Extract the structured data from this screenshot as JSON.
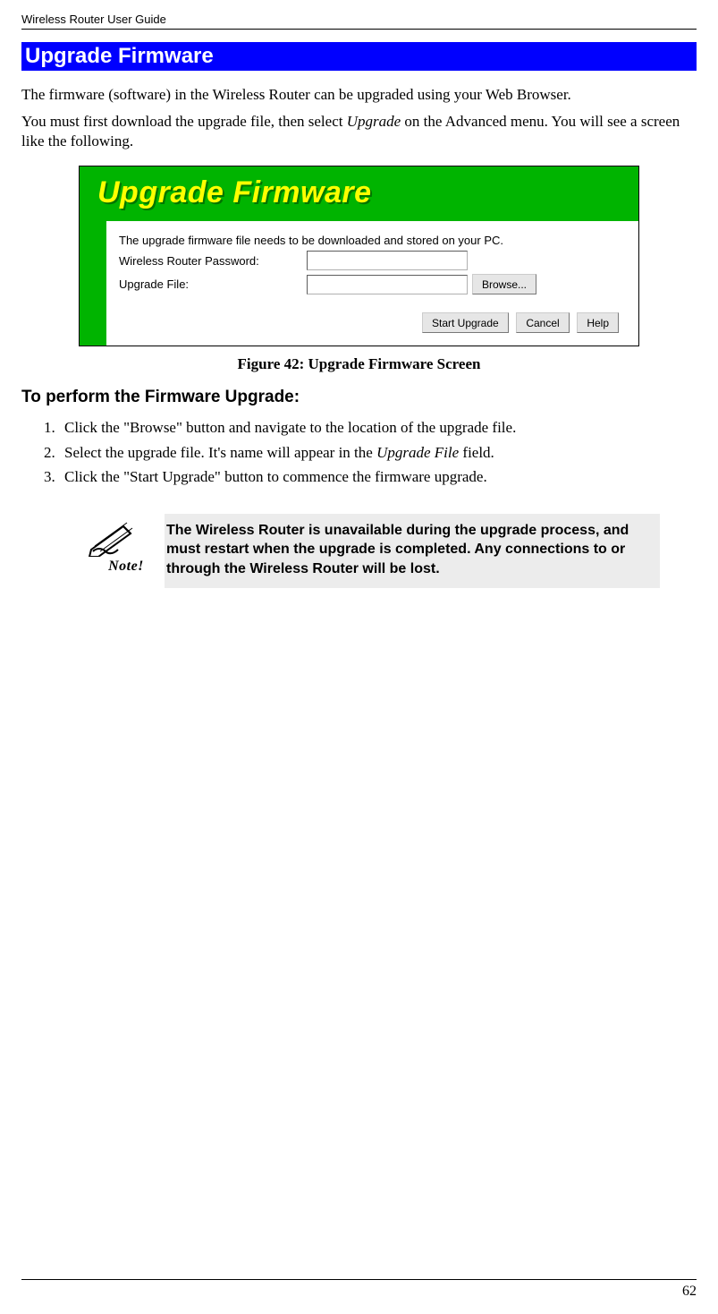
{
  "header": {
    "doc_title": "Wireless Router User Guide"
  },
  "section": {
    "title": "Upgrade Firmware"
  },
  "para1": "The firmware (software) in the Wireless Router can be upgraded using your Web Browser.",
  "para2_a": "You must first download the upgrade file, then select ",
  "para2_i": "Upgrade",
  "para2_b": " on the Advanced menu. You will see a screen like the following.",
  "screenshot": {
    "banner": "Upgrade Firmware",
    "instr": "The upgrade firmware file needs to be downloaded and stored on your PC.",
    "label_pw": "Wireless Router Password:",
    "label_file": "Upgrade File:",
    "btn_browse": "Browse...",
    "btn_start": "Start Upgrade",
    "btn_cancel": "Cancel",
    "btn_help": "Help"
  },
  "caption": "Figure 42: Upgrade Firmware Screen",
  "subhead": "To perform the Firmware Upgrade:",
  "steps": {
    "s1": "Click the \"Browse\" button and navigate to the location of the upgrade file.",
    "s2_a": "Select the upgrade file. It's name will appear in the ",
    "s2_i": "Upgrade File",
    "s2_b": " field.",
    "s3": "Click the \"Start Upgrade\" button to commence the firmware upgrade."
  },
  "note": {
    "label": "Note!",
    "text": "The Wireless Router is unavailable during the upgrade process, and must restart when the upgrade is completed. Any connections to or through the Wireless Router will be lost."
  },
  "footer": {
    "page": "62"
  }
}
